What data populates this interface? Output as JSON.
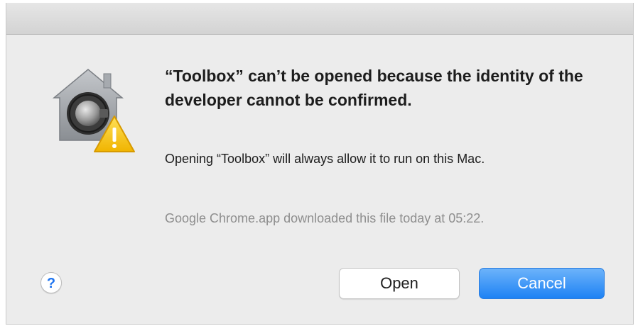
{
  "dialog": {
    "icon": "gatekeeper-lock-warning-icon",
    "heading": "“Toolbox” can’t be opened because the identity of the developer cannot be confirmed.",
    "message": "Opening “Toolbox” will always allow it to run on this Mac.",
    "source_info": "Google Chrome.app downloaded this file today at 05:22.",
    "help_label": "?",
    "buttons": {
      "open_label": "Open",
      "cancel_label": "Cancel"
    }
  },
  "colors": {
    "accent": "#1e82f4",
    "help_glyph": "#1e74f0",
    "warning": "#f4c21b",
    "background": "#ececec"
  }
}
